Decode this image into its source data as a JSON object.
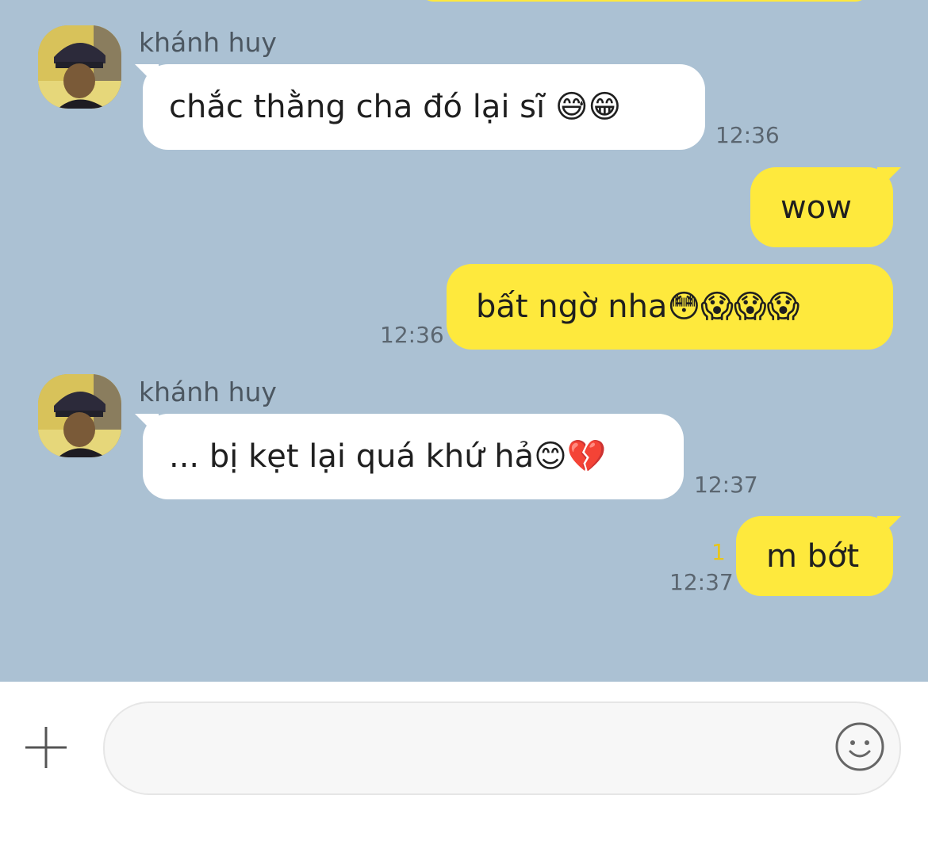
{
  "messages": [
    {
      "sender": "khánh huy",
      "text": "chắc thằng cha đó lại sĩ 😅😁",
      "time": "12:36",
      "direction": "in"
    },
    {
      "text": "wow",
      "time": "",
      "direction": "out"
    },
    {
      "text": "bất ngờ nha😳😱😱😱",
      "time": "12:36",
      "direction": "out"
    },
    {
      "sender": "khánh huy",
      "text": "... bị kẹt lại quá khứ hả😊💔",
      "time": "12:37",
      "direction": "in"
    },
    {
      "text": "m bớt",
      "time": "12:37",
      "unread": "1",
      "direction": "out"
    }
  ],
  "composer": {
    "input_value": "",
    "plus_icon": "plus-icon",
    "emoji_icon": "smiley-icon"
  },
  "colors": {
    "background": "#abc1d3",
    "incoming_bubble": "#ffffff",
    "outgoing_bubble": "#fee93d",
    "unread": "#e8c51a"
  }
}
